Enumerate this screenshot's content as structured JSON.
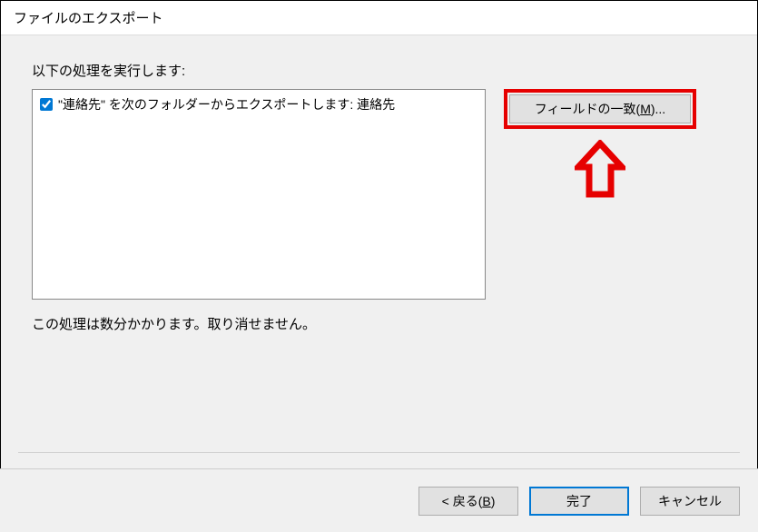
{
  "title": "ファイルのエクスポート",
  "instruction": "以下の処理を実行します:",
  "list": {
    "item_label": "\"連絡先\" を次のフォルダーからエクスポートします: 連絡先",
    "item_checked": true
  },
  "map_fields": {
    "prefix": "フィールドの一致(",
    "mnemonic": "M",
    "suffix": ")..."
  },
  "note": "この処理は数分かかります。取り消せません。",
  "buttons": {
    "back_prefix": "< 戻る(",
    "back_mnemonic": "B",
    "back_suffix": ")",
    "finish": "完了",
    "cancel": "キャンセル"
  }
}
